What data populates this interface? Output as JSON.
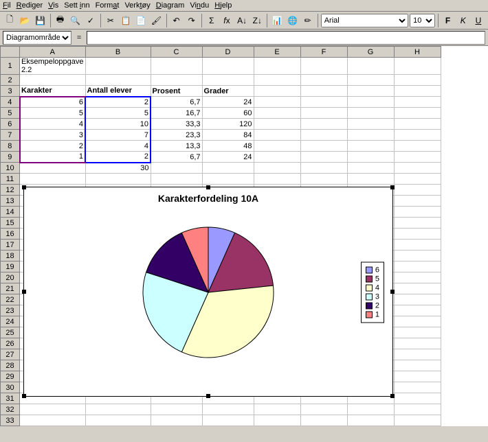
{
  "menu": [
    "Fil",
    "Rediger",
    "Vis",
    "Sett inn",
    "Format",
    "Verktøy",
    "Diagram",
    "Vindu",
    "Hjelp"
  ],
  "toolbar": {
    "font": "Arial",
    "size": "10"
  },
  "namebox": "Diagramområde",
  "columns": [
    "A",
    "B",
    "C",
    "D",
    "E",
    "F",
    "G",
    "H"
  ],
  "sheet": {
    "title_cell": "Eksempeloppgave 2.2",
    "headers": {
      "A": "Karakter",
      "B": "Antall elever",
      "C": "Prosent",
      "D": "Grader"
    },
    "rows": [
      {
        "A": "6",
        "B": "2",
        "C": "6,7",
        "D": "24"
      },
      {
        "A": "5",
        "B": "5",
        "C": "16,7",
        "D": "60"
      },
      {
        "A": "4",
        "B": "10",
        "C": "33,3",
        "D": "120"
      },
      {
        "A": "3",
        "B": "7",
        "C": "23,3",
        "D": "84"
      },
      {
        "A": "2",
        "B": "4",
        "C": "13,3",
        "D": "48"
      },
      {
        "A": "1",
        "B": "2",
        "C": "6,7",
        "D": "24"
      }
    ],
    "sum_b": "30"
  },
  "chart_data": {
    "type": "pie",
    "title": "Karakterfordeling 10A",
    "categories": [
      "6",
      "5",
      "4",
      "3",
      "2",
      "1"
    ],
    "values": [
      2,
      5,
      10,
      7,
      4,
      2
    ],
    "degrees": [
      24,
      60,
      120,
      84,
      48,
      24
    ],
    "colors": [
      "#9999ff",
      "#993366",
      "#ffffcc",
      "#ccffff",
      "#330066",
      "#ff8080"
    ],
    "legend": [
      "6",
      "5",
      "4",
      "3",
      "2",
      "1"
    ]
  }
}
